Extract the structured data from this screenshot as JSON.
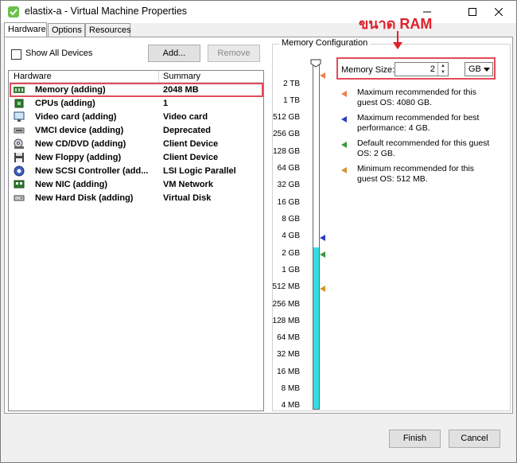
{
  "window": {
    "title": "elastix-a - Virtual Machine Properties"
  },
  "tabs": [
    {
      "label": "Hardware",
      "active": true
    },
    {
      "label": "Options",
      "active": false
    },
    {
      "label": "Resources",
      "active": false
    }
  ],
  "toolbar": {
    "show_all_devices": "Show All Devices",
    "add_label": "Add...",
    "remove_label": "Remove"
  },
  "hardware": {
    "col_hardware": "Hardware",
    "col_summary": "Summary",
    "rows": [
      {
        "name": "Memory (adding)",
        "summary": "2048 MB",
        "icon": "memory-icon",
        "selected": true
      },
      {
        "name": "CPUs (adding)",
        "summary": "1",
        "icon": "cpu-icon"
      },
      {
        "name": "Video card  (adding)",
        "summary": "Video card",
        "icon": "video-card-icon"
      },
      {
        "name": "VMCI device (adding)",
        "summary": "Deprecated",
        "icon": "vmci-device-icon"
      },
      {
        "name": "New CD/DVD (adding)",
        "summary": "Client Device",
        "icon": "cd-dvd-icon"
      },
      {
        "name": "New Floppy (adding)",
        "summary": "Client Device",
        "icon": "floppy-icon"
      },
      {
        "name": "New SCSI Controller (add...",
        "summary": "LSI Logic Parallel",
        "icon": "scsi-controller-icon"
      },
      {
        "name": "New NIC (adding)",
        "summary": "VM Network",
        "icon": "nic-icon"
      },
      {
        "name": "New Hard Disk (adding)",
        "summary": "Virtual Disk",
        "icon": "hard-disk-icon"
      }
    ]
  },
  "memory": {
    "group_title": "Memory Configuration",
    "size_label": "Memory Size:",
    "size_value": "2",
    "unit": "GB",
    "scale": [
      "2 TB",
      "1 TB",
      "512 GB",
      "256 GB",
      "128 GB",
      "64 GB",
      "32 GB",
      "16 GB",
      "8 GB",
      "4 GB",
      "2 GB",
      "1 GB",
      "512 MB",
      "256 MB",
      "128 MB",
      "64 MB",
      "32 MB",
      "16 MB",
      "8 MB",
      "4 MB"
    ],
    "recommendations": [
      {
        "text": "Maximum recommended for this guest OS: 4080 GB.",
        "color": "#f0804a"
      },
      {
        "text": "Maximum recommended for best performance: 4 GB.",
        "color": "#2a3fbf"
      },
      {
        "text": "Default recommended for this guest OS: 2 GB.",
        "color": "#3a9a3a"
      },
      {
        "text": "Minimum recommended for this guest OS: 512 MB.",
        "color": "#d4962a"
      }
    ],
    "fill_color": "#33dde0"
  },
  "annotation": {
    "text": "ขนาด RAM",
    "color": "#e0202b"
  },
  "buttons": {
    "finish": "Finish",
    "cancel": "Cancel"
  }
}
